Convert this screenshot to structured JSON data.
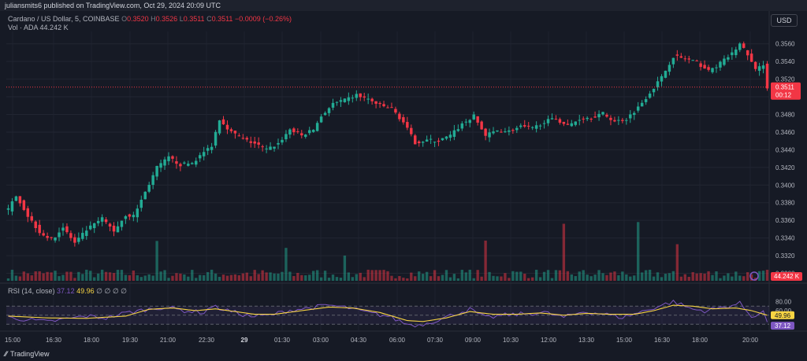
{
  "header": {
    "published": "juliansmits6 published on TradingView.com, Oct 29, 2024 20:09 UTC"
  },
  "legend": {
    "symbol": "Cardano / US Dollar, 5, COINBASE",
    "o_label": "O",
    "o": "0.3520",
    "h_label": "H",
    "h": "0.3526",
    "l_label": "L",
    "l": "0.3511",
    "c_label": "C",
    "c": "0.3511",
    "change": "−0.0009 (−0.26%)",
    "vol_label": "Vol · ADA",
    "vol": "44.242 K"
  },
  "rsi_legend": {
    "label": "RSI (14, close)",
    "rsi": "37.12",
    "ma": "49.96",
    "extras": "∅ ∅ ∅ ∅"
  },
  "currency": "USD",
  "brand": "TradingView",
  "colors": {
    "up": "#22ab94",
    "down": "#f23645",
    "rsi": "#7e57c2",
    "rsi_ma": "#f7d443",
    "bg": "#161a25"
  },
  "chart_data": {
    "type": "candlestick",
    "price_axis": {
      "ticks": [
        "0.3560",
        "0.3540",
        "0.3520",
        "0.3500",
        "0.3480",
        "0.3460",
        "0.3440",
        "0.3420",
        "0.3400",
        "0.3380",
        "0.3360",
        "0.3340",
        "0.3320",
        "0.3300"
      ],
      "ylim": [
        0.3296,
        0.3574
      ]
    },
    "last_price": "0.3511",
    "countdown": "00:12",
    "volume_label": "44.242 K",
    "rsi_axis": {
      "ticks": [
        "80.00",
        "60.00"
      ],
      "value_labels": [
        "49.96",
        "37.12"
      ]
    },
    "time_ticks": [
      "15:00",
      "16:30",
      "18:00",
      "19:30",
      "21:00",
      "22:30",
      "29",
      "01:30",
      "03:00",
      "04:30",
      "06:00",
      "07:30",
      "09:00",
      "10:30",
      "12:00",
      "13:30",
      "15:00",
      "16:30",
      "18:00",
      "20:00"
    ],
    "price_path": [
      [
        0,
        0.3372
      ],
      [
        2,
        0.3389
      ],
      [
        5,
        0.3365
      ],
      [
        8,
        0.3347
      ],
      [
        11,
        0.3338
      ],
      [
        14,
        0.3352
      ],
      [
        17,
        0.3334
      ],
      [
        20,
        0.3349
      ],
      [
        24,
        0.3362
      ],
      [
        27,
        0.3348
      ],
      [
        30,
        0.3366
      ],
      [
        32,
        0.3365
      ],
      [
        35,
        0.3392
      ],
      [
        38,
        0.342
      ],
      [
        41,
        0.3431
      ],
      [
        44,
        0.3423
      ],
      [
        47,
        0.3425
      ],
      [
        50,
        0.3437
      ],
      [
        52,
        0.3445
      ],
      [
        54,
        0.3475
      ],
      [
        57,
        0.346
      ],
      [
        60,
        0.3452
      ],
      [
        63,
        0.3447
      ],
      [
        66,
        0.344
      ],
      [
        69,
        0.3447
      ],
      [
        72,
        0.3463
      ],
      [
        75,
        0.3456
      ],
      [
        78,
        0.3463
      ],
      [
        80,
        0.3478
      ],
      [
        83,
        0.3492
      ],
      [
        86,
        0.3496
      ],
      [
        89,
        0.3502
      ],
      [
        92,
        0.3497
      ],
      [
        95,
        0.349
      ],
      [
        98,
        0.3487
      ],
      [
        101,
        0.3471
      ],
      [
        104,
        0.3448
      ],
      [
        107,
        0.3451
      ],
      [
        110,
        0.345
      ],
      [
        113,
        0.3456
      ],
      [
        116,
        0.3469
      ],
      [
        119,
        0.3478
      ],
      [
        122,
        0.3456
      ],
      [
        125,
        0.3462
      ],
      [
        128,
        0.3461
      ],
      [
        131,
        0.3466
      ],
      [
        134,
        0.3464
      ],
      [
        137,
        0.3472
      ],
      [
        140,
        0.3475
      ],
      [
        143,
        0.3467
      ],
      [
        146,
        0.3475
      ],
      [
        149,
        0.3477
      ],
      [
        152,
        0.3481
      ],
      [
        155,
        0.3472
      ],
      [
        158,
        0.3475
      ],
      [
        161,
        0.3488
      ],
      [
        164,
        0.3505
      ],
      [
        167,
        0.3522
      ],
      [
        170,
        0.3546
      ],
      [
        173,
        0.3543
      ],
      [
        176,
        0.3539
      ],
      [
        179,
        0.3529
      ],
      [
        182,
        0.3538
      ],
      [
        185,
        0.3549
      ],
      [
        187,
        0.356
      ],
      [
        189,
        0.3548
      ],
      [
        191,
        0.353
      ],
      [
        193,
        0.3537
      ],
      [
        194,
        0.3511
      ]
    ],
    "rsi_path": [
      [
        0,
        45
      ],
      [
        5,
        40
      ],
      [
        10,
        35
      ],
      [
        15,
        42
      ],
      [
        20,
        48
      ],
      [
        25,
        44
      ],
      [
        30,
        55
      ],
      [
        35,
        62
      ],
      [
        40,
        68
      ],
      [
        45,
        60
      ],
      [
        50,
        56
      ],
      [
        52,
        70
      ],
      [
        57,
        58
      ],
      [
        62,
        47
      ],
      [
        67,
        50
      ],
      [
        72,
        61
      ],
      [
        77,
        66
      ],
      [
        82,
        72
      ],
      [
        87,
        66
      ],
      [
        92,
        55
      ],
      [
        97,
        48
      ],
      [
        102,
        30
      ],
      [
        105,
        28
      ],
      [
        110,
        40
      ],
      [
        115,
        55
      ],
      [
        118,
        63
      ],
      [
        122,
        44
      ],
      [
        127,
        50
      ],
      [
        132,
        53
      ],
      [
        137,
        56
      ],
      [
        142,
        45
      ],
      [
        147,
        58
      ],
      [
        152,
        53
      ],
      [
        157,
        45
      ],
      [
        162,
        58
      ],
      [
        167,
        72
      ],
      [
        170,
        80
      ],
      [
        175,
        63
      ],
      [
        178,
        60
      ],
      [
        182,
        66
      ],
      [
        187,
        76
      ],
      [
        190,
        48
      ],
      [
        193,
        57
      ],
      [
        194,
        37
      ]
    ],
    "rsi_ma_path": [
      [
        0,
        48
      ],
      [
        10,
        44
      ],
      [
        20,
        43
      ],
      [
        30,
        48
      ],
      [
        36,
        63
      ],
      [
        42,
        66
      ],
      [
        48,
        60
      ],
      [
        53,
        64
      ],
      [
        58,
        58
      ],
      [
        63,
        52
      ],
      [
        68,
        52
      ],
      [
        75,
        60
      ],
      [
        82,
        68
      ],
      [
        88,
        66
      ],
      [
        95,
        56
      ],
      [
        102,
        38
      ],
      [
        106,
        36
      ],
      [
        112,
        44
      ],
      [
        118,
        58
      ],
      [
        124,
        52
      ],
      [
        130,
        52
      ],
      [
        136,
        55
      ],
      [
        142,
        50
      ],
      [
        148,
        54
      ],
      [
        154,
        52
      ],
      [
        160,
        52
      ],
      [
        165,
        60
      ],
      [
        170,
        72
      ],
      [
        175,
        70
      ],
      [
        180,
        64
      ],
      [
        186,
        66
      ],
      [
        190,
        60
      ],
      [
        194,
        49.96
      ]
    ]
  }
}
